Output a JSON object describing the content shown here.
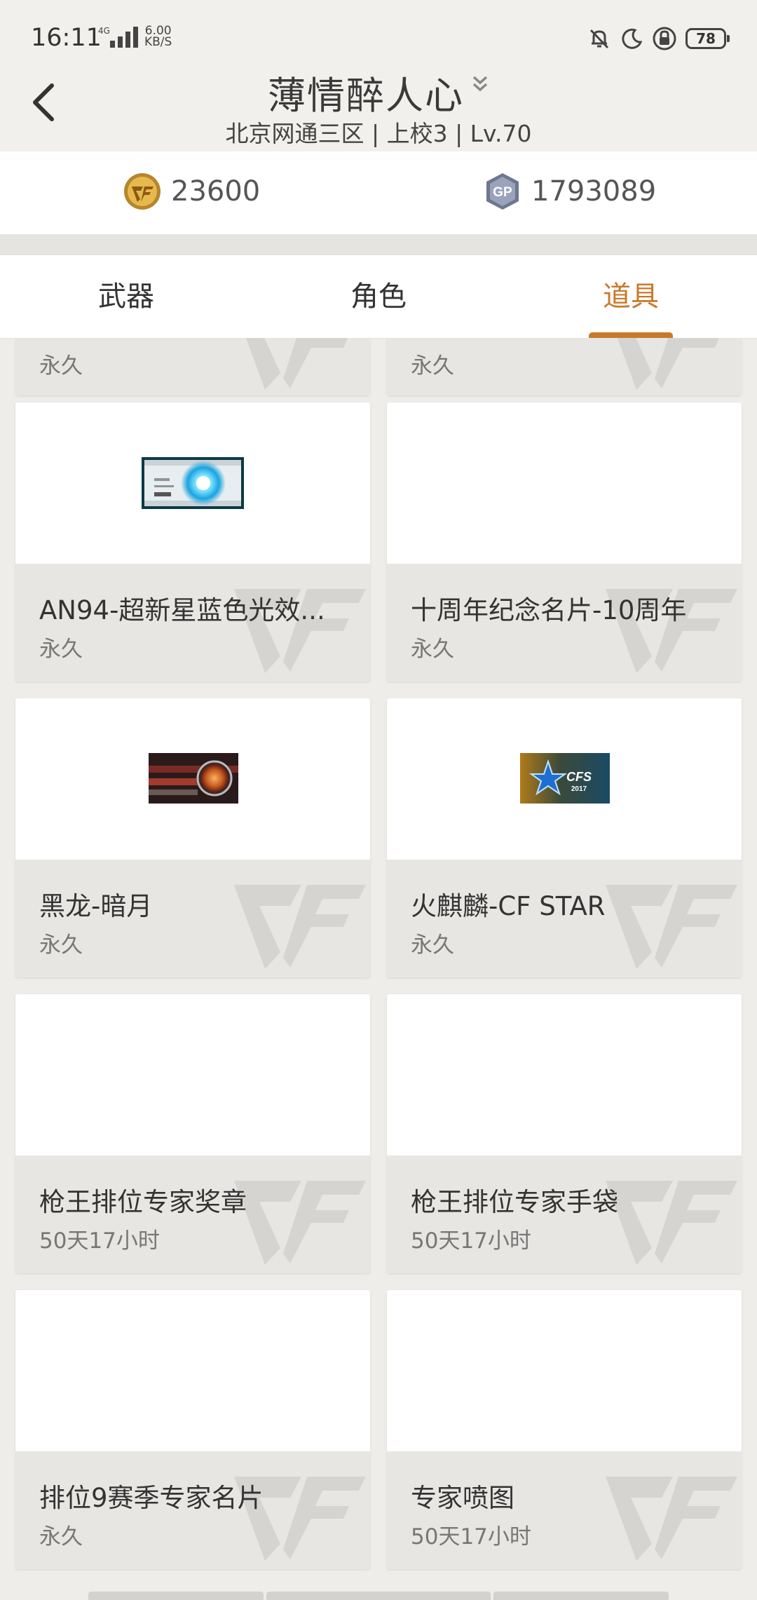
{
  "status": {
    "time": "16:11",
    "network": "4G",
    "speed_value": "6.00",
    "speed_unit": "KB/S",
    "battery": "78"
  },
  "header": {
    "title": "薄情醉人心",
    "subtitle": "北京网通三区 | 上校3 | Lv.70"
  },
  "currency": {
    "cf_points": "23600",
    "gp": "1793089",
    "gp_icon_text": "GP"
  },
  "tabs": [
    {
      "label": "武器",
      "active": false
    },
    {
      "label": "角色",
      "active": false
    },
    {
      "label": "道具",
      "active": true
    }
  ],
  "accent_color": "#c8792b",
  "items": [
    {
      "name": "",
      "duration": "永久",
      "thumbnail": "none"
    },
    {
      "name": "",
      "duration": "永久",
      "thumbnail": "none"
    },
    {
      "name": "AN94-超新星蓝色光效...",
      "duration": "永久",
      "thumbnail": "blue-light-card"
    },
    {
      "name": "十周年纪念名片-10周年",
      "duration": "永久",
      "thumbnail": "none"
    },
    {
      "name": "黑龙-暗月",
      "duration": "永久",
      "thumbnail": "dark-dragon-moon"
    },
    {
      "name": "火麒麟-CF STAR",
      "duration": "永久",
      "thumbnail": "cfs-star-logo"
    },
    {
      "name": "枪王排位专家奖章",
      "duration": "50天17小时",
      "thumbnail": "none"
    },
    {
      "name": "枪王排位专家手袋",
      "duration": "50天17小时",
      "thumbnail": "none"
    },
    {
      "name": "排位9赛季专家名片",
      "duration": "永久",
      "thumbnail": "none"
    },
    {
      "name": "专家喷图",
      "duration": "50天17小时",
      "thumbnail": "none"
    }
  ],
  "thumb_text": {
    "cfs": "CFS",
    "cfs_year": "2017"
  }
}
